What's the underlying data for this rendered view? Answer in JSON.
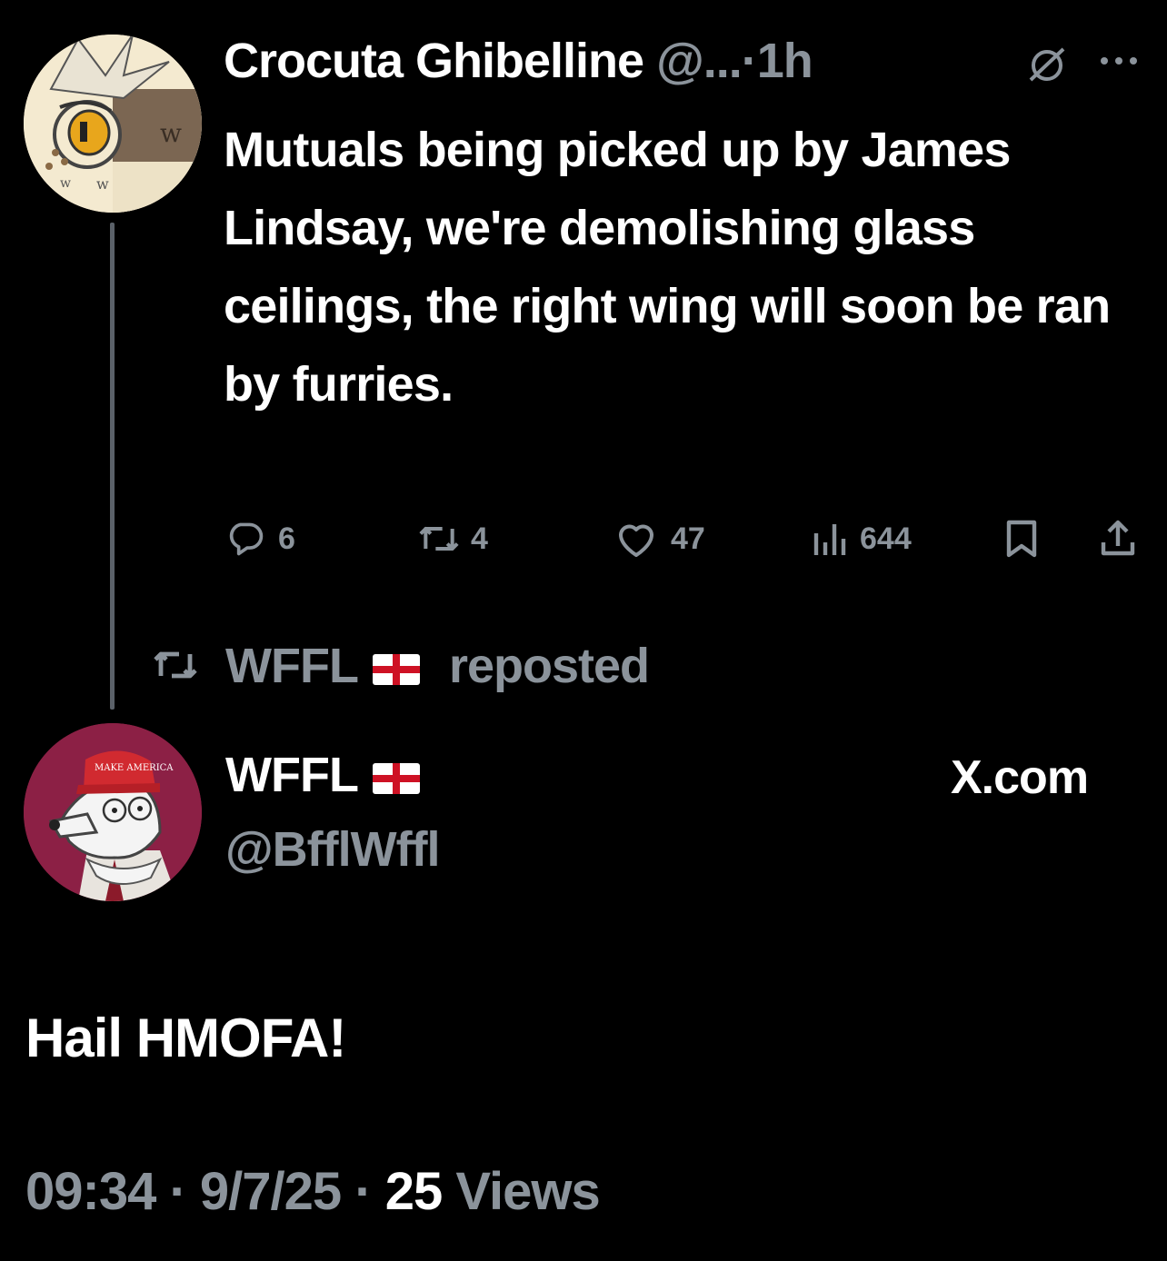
{
  "quoted_post": {
    "author_name": "Crocuta Ghibelline",
    "handle_truncated": "@...",
    "separator": "·",
    "time_ago": "1h",
    "text": "Mutuals being picked up by James Lindsay, we're demolishing glass ceilings, the right wing will soon be ran by furries.",
    "actions": {
      "replies": "6",
      "reposts": "4",
      "likes": "47",
      "views": "644"
    }
  },
  "repost_banner": {
    "name": "WFFL",
    "suffix": "reposted"
  },
  "main_post": {
    "author_name": "WFFL",
    "handle": "@BfflWffl",
    "source": "X.com",
    "text": "Hail HMOFA!",
    "timestamp": "09:34",
    "date": "9/7/25",
    "dot": "·",
    "views_count": "25",
    "views_label": "Views"
  },
  "colors": {
    "background": "#000000",
    "text": "#ffffff",
    "muted": "#8b939b",
    "thread_line": "#5b6169",
    "avatar2_bg": "#8c2045"
  },
  "icons": [
    "grok-icon",
    "more-icon",
    "reply-icon",
    "repost-icon",
    "like-icon",
    "views-icon",
    "bookmark-icon",
    "share-icon"
  ]
}
